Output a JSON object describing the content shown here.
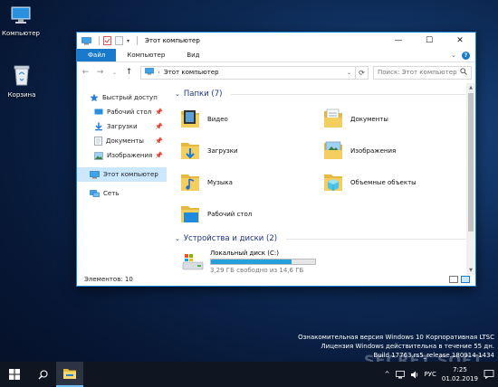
{
  "desktop": {
    "icons": [
      {
        "label": "Компьютер",
        "icon": "computer-icon"
      },
      {
        "label": "Корзина",
        "icon": "recycle-bin-icon"
      }
    ],
    "watermark": {
      "line1": "Ознакомительная версия Windows 10 Корпоративная LTSC",
      "line2": "Лицензия Windows действительна в течение 55 дн.",
      "line3": "Build 17763.rs5_release.180914-1434"
    },
    "brand_watermark": "SECRET SOFT"
  },
  "window": {
    "title": "Этот компьютер",
    "controls": {
      "minimize": "—",
      "maximize": "☐",
      "close": "✕"
    },
    "ribbon_tabs": [
      "Файл",
      "Компьютер",
      "Вид"
    ],
    "address": {
      "path": "Этот компьютер",
      "search_placeholder": "Поиск: Этот компьютер"
    },
    "nav": {
      "quick_access": "Быстрый доступ",
      "pinned": [
        {
          "label": "Рабочий стол",
          "icon": "desktop-folder-icon"
        },
        {
          "label": "Загрузки",
          "icon": "downloads-icon"
        },
        {
          "label": "Документы",
          "icon": "documents-icon"
        },
        {
          "label": "Изображения",
          "icon": "pictures-icon"
        }
      ],
      "this_pc": "Этот компьютер",
      "network": "Сеть"
    },
    "folders_header": "Папки (7)",
    "folders": [
      {
        "label": "Видео",
        "icon": "videos-folder-icon"
      },
      {
        "label": "Документы",
        "icon": "documents-folder-icon"
      },
      {
        "label": "Загрузки",
        "icon": "downloads-folder-icon"
      },
      {
        "label": "Изображения",
        "icon": "pictures-folder-icon"
      },
      {
        "label": "Музыка",
        "icon": "music-folder-icon"
      },
      {
        "label": "Объемные объекты",
        "icon": "3d-objects-folder-icon"
      },
      {
        "label": "Рабочий стол",
        "icon": "desktop-folder-icon"
      }
    ],
    "drives_header": "Устройства и диски (2)",
    "drive": {
      "label": "Локальный диск (C:)",
      "free_text": "3,29 ГБ свободно из 14,6 ГБ",
      "used_fraction": 0.775
    },
    "status": "Элементов: 10"
  },
  "taskbar": {
    "lang": "РУС",
    "time": "7:25",
    "date": "01.02.2019"
  },
  "colors": {
    "accent": "#1979ca",
    "folder": "#f2c94c",
    "drive_fill": "#26a0da"
  }
}
